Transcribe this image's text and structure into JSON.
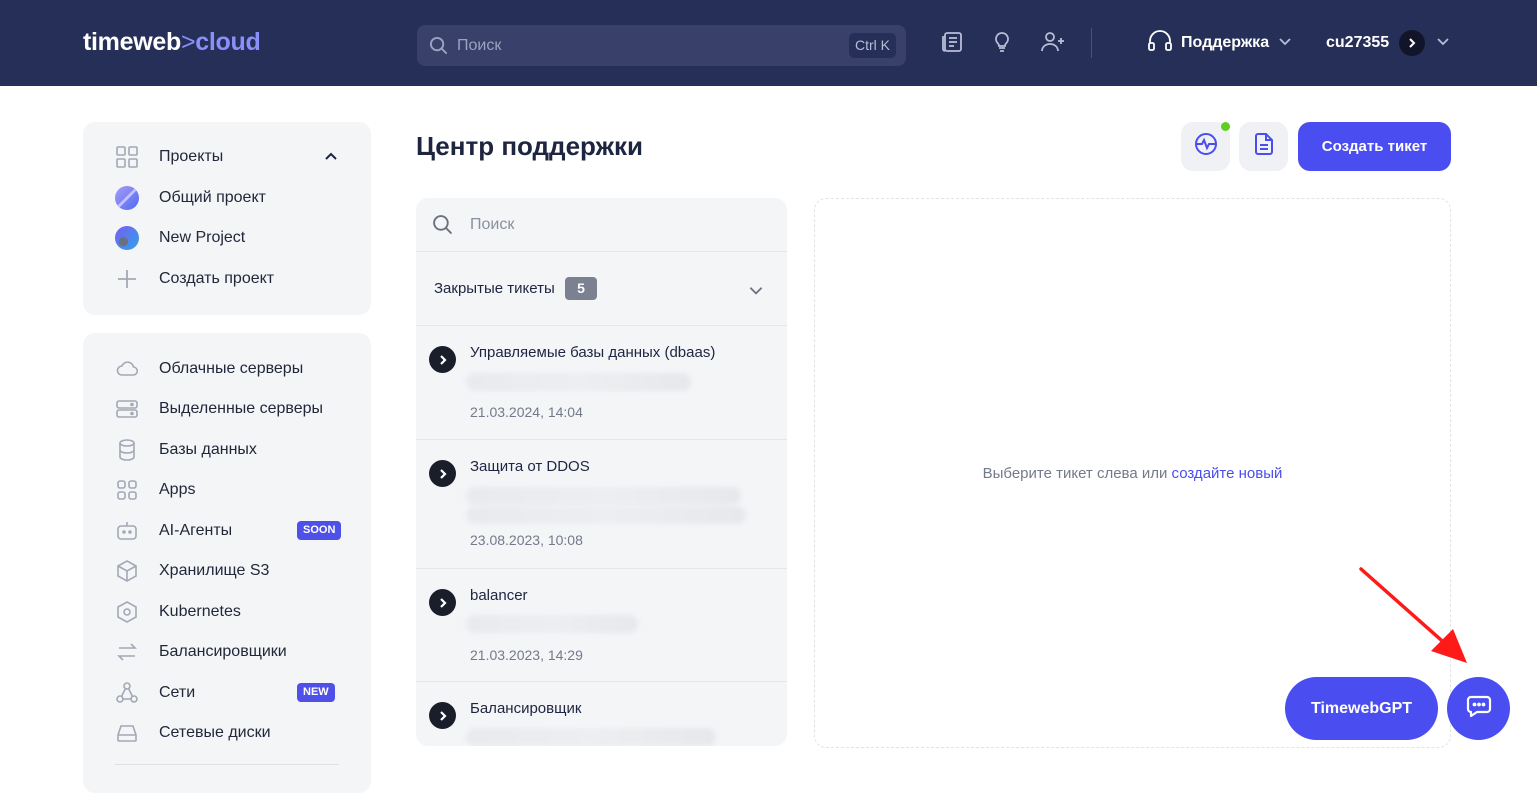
{
  "header": {
    "logo_main": "timeweb",
    "logo_sep": ">",
    "logo_cloud": "cloud",
    "search_placeholder": "Поиск",
    "search_shortcut": "Ctrl K",
    "support_label": "Поддержка",
    "username": "cu27355"
  },
  "projects": {
    "title": "Проекты",
    "items": [
      {
        "label": "Общий проект"
      },
      {
        "label": "New Project"
      },
      {
        "label": "Создать проект"
      }
    ]
  },
  "nav": {
    "items": [
      {
        "label": "Облачные серверы",
        "icon": "cloud-icon"
      },
      {
        "label": "Выделенные серверы",
        "icon": "server-icon"
      },
      {
        "label": "Базы данных",
        "icon": "database-icon"
      },
      {
        "label": "Apps",
        "icon": "apps-icon"
      },
      {
        "label": "AI-Агенты",
        "icon": "robot-icon",
        "badge": "SOON"
      },
      {
        "label": "Хранилище S3",
        "icon": "cube-icon"
      },
      {
        "label": "Kubernetes",
        "icon": "kubernetes-icon"
      },
      {
        "label": "Балансировщики",
        "icon": "arrows-icon"
      },
      {
        "label": "Сети",
        "icon": "network-icon",
        "badge": "NEW"
      },
      {
        "label": "Сетевые диски",
        "icon": "disk-icon"
      }
    ]
  },
  "main": {
    "title": "Центр поддержки",
    "create_ticket": "Создать тикет",
    "status_dot_color": "#5fcf1f"
  },
  "tickets": {
    "search_placeholder": "Поиск",
    "closed_label": "Закрытые тикеты",
    "closed_count": "5",
    "items": [
      {
        "title": "Управляемые базы данных (dbaas)",
        "date": "21.03.2024, 14:04"
      },
      {
        "title": "Защита от DDOS",
        "date": "23.08.2023, 10:08"
      },
      {
        "title": "balancer",
        "date": "21.03.2023, 14:29"
      },
      {
        "title": "Балансировщик",
        "date": ""
      }
    ]
  },
  "empty_state": {
    "text": "Выберите тикет слева или ",
    "link": "создайте новый"
  },
  "floating": {
    "gpt_label": "TimewebGPT"
  },
  "colors": {
    "header_bg": "#262f57",
    "accent": "#4a4ef0",
    "annotation_arrow": "#ff1a1a"
  }
}
